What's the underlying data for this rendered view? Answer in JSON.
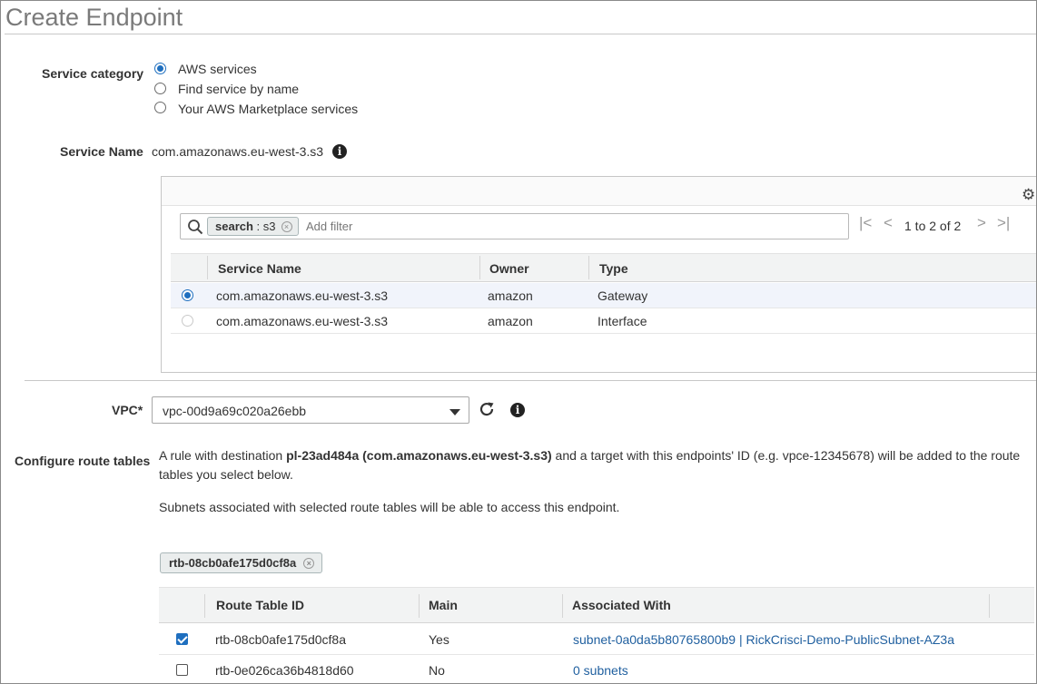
{
  "page_title": "Create Endpoint",
  "service_category": {
    "label": "Service category",
    "options": [
      {
        "label": "AWS services",
        "selected": true
      },
      {
        "label": "Find service by name",
        "selected": false
      },
      {
        "label": "Your AWS Marketplace services",
        "selected": false
      }
    ]
  },
  "service_name": {
    "label": "Service Name",
    "value": "com.amazonaws.eu-west-3.s3",
    "info_icon": "i"
  },
  "service_table": {
    "settings_icon": "⚙",
    "filter": {
      "token_key": "search",
      "token_sep": " : ",
      "token_value": "s3",
      "placeholder": "Add filter"
    },
    "pagination": {
      "first": "|<",
      "prev": "<",
      "text": "1 to 2 of 2",
      "next": ">",
      "last": ">|"
    },
    "columns": [
      "Service Name",
      "Owner",
      "Type"
    ],
    "rows": [
      {
        "service_name": "com.amazonaws.eu-west-3.s3",
        "owner": "amazon",
        "type": "Gateway",
        "selected": true
      },
      {
        "service_name": "com.amazonaws.eu-west-3.s3",
        "owner": "amazon",
        "type": "Interface",
        "selected": false
      }
    ]
  },
  "vpc": {
    "label": "VPC*",
    "value": "vpc-00d9a69c020a26ebb",
    "info_icon": "i"
  },
  "route_tables": {
    "label": "Configure route tables",
    "description_prefix": "A rule with destination ",
    "description_bold": "pl-23ad484a (com.amazonaws.eu-west-3.s3)",
    "description_suffix": " and a target with this endpoints' ID (e.g. vpce-12345678) will be added to the route tables you select below.",
    "note": "Subnets associated with selected route tables will be able to access this endpoint.",
    "selected_chip": "rtb-08cb0afe175d0cf8a",
    "columns": [
      "Route Table ID",
      "Main",
      "Associated With"
    ],
    "rows": [
      {
        "id": "rtb-08cb0afe175d0cf8a",
        "main": "Yes",
        "associated": "subnet-0a0da5b80765800b9 | RickCrisci-Demo-PublicSubnet-AZ3a",
        "checked": true
      },
      {
        "id": "rtb-0e026ca36b4818d60",
        "main": "No",
        "associated": "0 subnets",
        "checked": false
      }
    ]
  }
}
